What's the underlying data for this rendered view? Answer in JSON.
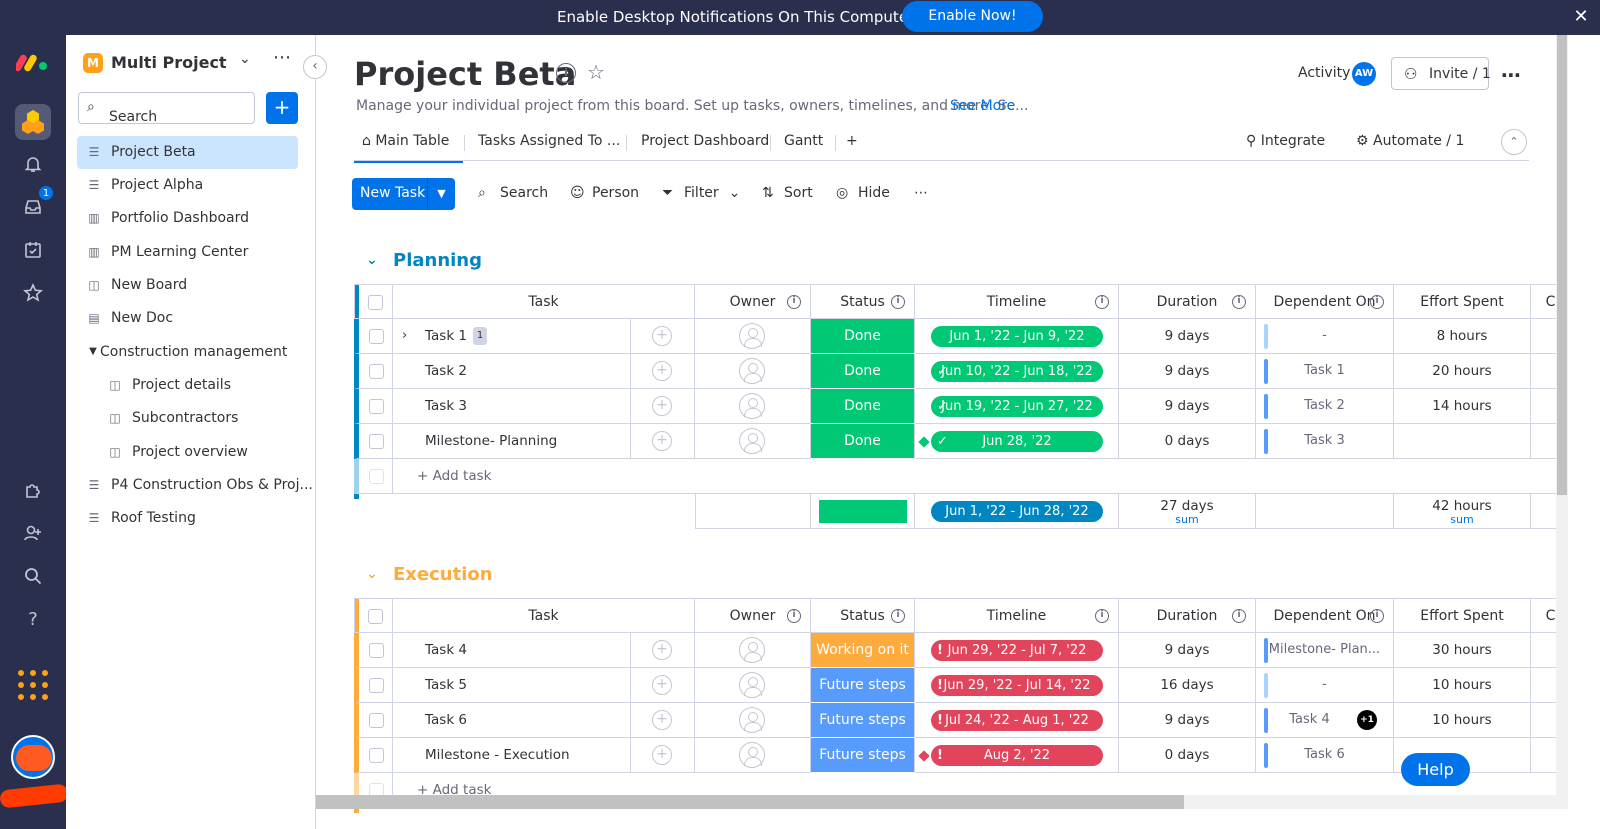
{
  "banner": {
    "message": "Enable Desktop Notifications On This Computer",
    "button": "Enable Now!"
  },
  "rail": {
    "notification_count": "1"
  },
  "workspace": {
    "initial": "M",
    "name": "Multi Project"
  },
  "sidebar": {
    "search_placeholder": "Search",
    "items": [
      {
        "label": "Project Beta"
      },
      {
        "label": "Project Alpha"
      },
      {
        "label": "Portfolio Dashboard"
      },
      {
        "label": "PM Learning Center"
      },
      {
        "label": "New Board"
      },
      {
        "label": "New Doc"
      },
      {
        "label": "Construction management"
      },
      {
        "label": "Project details"
      },
      {
        "label": "Subcontractors"
      },
      {
        "label": "Project overview"
      },
      {
        "label": "P4 Construction Obs & Proj..."
      },
      {
        "label": "Roof Testing"
      }
    ]
  },
  "board": {
    "title": "Project Beta",
    "description": "Manage your individual project from this board. Set up tasks, owners, timelines, and more. Se...",
    "see_more": "See More",
    "activity": "Activity",
    "avatar_initials": "AW",
    "invite": "Invite / 1"
  },
  "tabs": {
    "main_table": "Main Table",
    "assigned": "Tasks Assigned To ...",
    "dashboard": "Project Dashboard",
    "gantt": "Gantt",
    "add": "+",
    "integrate": "Integrate",
    "automate": "Automate / 1"
  },
  "toolbar": {
    "new_task": "New Task",
    "search": "Search",
    "person": "Person",
    "filter": "Filter",
    "sort": "Sort",
    "hide": "Hide"
  },
  "columns": {
    "task": "Task",
    "owner": "Owner",
    "status": "Status",
    "timeline": "Timeline",
    "duration": "Duration",
    "dependent": "Dependent On",
    "effort": "Effort Spent",
    "extra": "C"
  },
  "colors": {
    "done": "#00c875",
    "working": "#fdab3d",
    "future": "#579bfc",
    "overdue": "#e2445c",
    "planning_group": "#0086c0",
    "execution_group": "#fdab3d"
  },
  "groups": {
    "planning": {
      "name": "Planning",
      "add_task": "+ Add task",
      "rows": [
        {
          "task": "Task 1",
          "subitems": "1",
          "status": "Done",
          "timeline": "Jun 1, '22 - Jun 9, '22",
          "duration": "9 days",
          "dependent": "-",
          "effort": "8 hours"
        },
        {
          "task": "Task 2",
          "status": "Done",
          "timeline": "Jun 10, '22 - Jun 18, '22",
          "duration": "9 days",
          "dependent": "Task 1",
          "effort": "20 hours"
        },
        {
          "task": "Task 3",
          "status": "Done",
          "timeline": "Jun 19, '22 - Jun 27, '22",
          "duration": "9 days",
          "dependent": "Task 2",
          "effort": "14 hours"
        },
        {
          "task": "Milestone- Planning",
          "status": "Done",
          "timeline": "Jun 28, '22",
          "duration": "0 days",
          "dependent": "Task 3",
          "effort": ""
        }
      ],
      "summary": {
        "timeline": "Jun 1, '22 - Jun 28, '22",
        "duration": "27 days",
        "effort": "42 hours",
        "sum_label": "sum"
      }
    },
    "execution": {
      "name": "Execution",
      "add_task": "+ Add task",
      "rows": [
        {
          "task": "Task 4",
          "status": "Working on it",
          "timeline": "Jun 29, '22 - Jul 7, '22",
          "duration": "9 days",
          "dependent": "Milestone- Plan...",
          "effort": "30 hours"
        },
        {
          "task": "Task 5",
          "status": "Future steps",
          "timeline": "Jun 29, '22 - Jul 14, '22",
          "duration": "16 days",
          "dependent": "-",
          "effort": "10 hours"
        },
        {
          "task": "Task 6",
          "status": "Future steps",
          "timeline": "Jul 24, '22 - Aug 1, '22",
          "duration": "9 days",
          "dependent": "Task 4",
          "dependent_extra": "+1",
          "effort": "10 hours"
        },
        {
          "task": "Milestone - Execution",
          "status": "Future steps",
          "timeline": "Aug 2, '22",
          "duration": "0 days",
          "dependent": "Task 6",
          "effort": ""
        }
      ]
    }
  },
  "help": "Help"
}
